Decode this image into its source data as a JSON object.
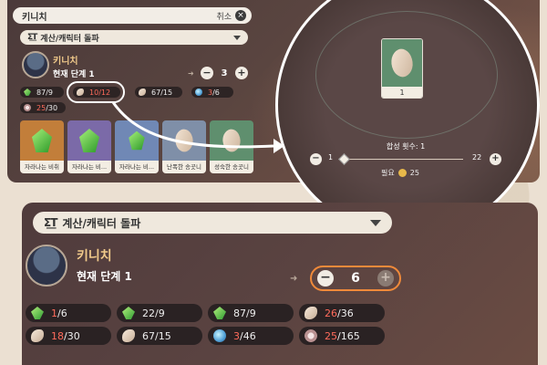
{
  "top": {
    "search": {
      "value": "키니치",
      "cancel_label": "취소",
      "clear_icon": "×"
    },
    "dropdown": {
      "icon_text": "Σ͟T",
      "label": "계산/캐릭터 돌파"
    },
    "character": {
      "name": "키니치",
      "stage": "현재 단계 1"
    },
    "stepper": {
      "minus": "−",
      "value": "3",
      "plus": "+"
    },
    "materials": [
      {
        "have": "87",
        "need": "/9",
        "icon": "green-gem-icon",
        "short": false
      },
      {
        "have": "10",
        "need": "/12",
        "icon": "tooth-icon",
        "short": true
      },
      {
        "have": "67",
        "need": "/15",
        "icon": "tooth-icon",
        "short": false
      },
      {
        "have": "3",
        "need": "/6",
        "icon": "orb-icon",
        "short": true
      },
      {
        "have": "25",
        "need": "/30",
        "icon": "flower-icon",
        "short": true
      }
    ],
    "cards": [
      {
        "label": "자라나는 비취",
        "icon": "green-gem-icon",
        "bg": "#c27e3a"
      },
      {
        "label": "자라나는 비...",
        "icon": "green-gem-icon",
        "bg": "#7b6aa8"
      },
      {
        "label": "자라나는 비...",
        "icon": "green-gem-icon",
        "bg": "#7088b5"
      },
      {
        "label": "난폭한 송곳니",
        "icon": "tooth-icon",
        "bg": "#7f8fa8"
      },
      {
        "label": "성숙한 송곳니",
        "icon": "tooth-icon",
        "bg": "#5f8f6e"
      }
    ],
    "zoom": {
      "card_label": "1",
      "synth_count": "합성 횟수: 1",
      "slider_min": "1",
      "slider_max": "22",
      "minus": "−",
      "plus": "+",
      "cost_label": "필요",
      "cost_value": "25"
    }
  },
  "bottom": {
    "dropdown": {
      "icon_text": "Σ͟T",
      "label": "계산/캐릭터 돌파"
    },
    "character": {
      "name": "키니치",
      "stage": "현재 단계 1"
    },
    "stepper": {
      "minus": "−",
      "value": "6",
      "plus": "+"
    },
    "materials": [
      {
        "have": "1",
        "need": "/6",
        "icon": "green-gem-icon",
        "short": true
      },
      {
        "have": "22",
        "need": "/9",
        "icon": "green-gem-icon",
        "short": false
      },
      {
        "have": "87",
        "need": "/9",
        "icon": "green-gem-icon",
        "short": false
      },
      {
        "have": "26",
        "need": "/36",
        "icon": "tooth-icon",
        "short": true
      },
      {
        "have": "18",
        "need": "/30",
        "icon": "tooth-icon",
        "short": true
      },
      {
        "have": "67",
        "need": "/15",
        "icon": "tooth-icon",
        "short": false
      },
      {
        "have": "3",
        "need": "/46",
        "icon": "orb-icon",
        "short": true
      },
      {
        "have": "25",
        "need": "/165",
        "icon": "flower-icon",
        "short": true
      }
    ]
  },
  "colors": {
    "accent_orange": "#f08a3a",
    "shortage_red": "#ff6b5b",
    "name_gold": "#f0c98a"
  }
}
